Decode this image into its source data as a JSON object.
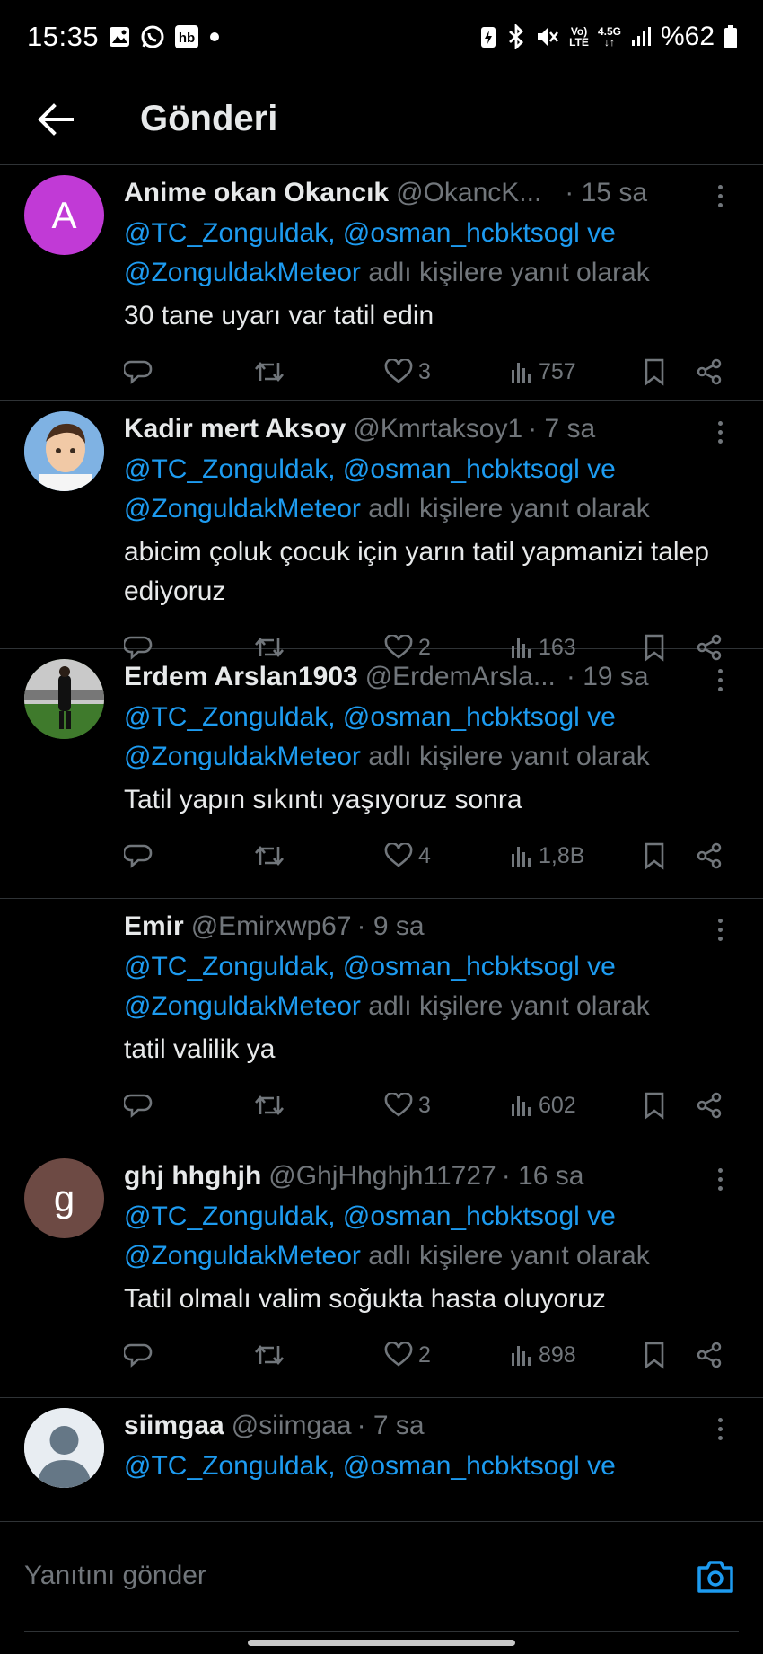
{
  "status_bar": {
    "time": "15:35",
    "left_icons": [
      "image-icon",
      "whatsapp-icon",
      "hb-app-icon",
      "dot-icon"
    ],
    "hb_label": "hb",
    "right_icons": [
      "battery-saver-icon",
      "bluetooth-icon",
      "mute-icon",
      "volte-icon",
      "network-4-5g-icon",
      "signal-icon",
      "battery-icon"
    ],
    "volte_top": "Vo)",
    "volte_bottom": "LTE",
    "network_top": "4.5G",
    "battery": "%62"
  },
  "header": {
    "title": "Gönderi"
  },
  "tweets": [
    {
      "name": "Anime okan Okancık",
      "handle": "@OkancK...",
      "time": "· 15 sa",
      "avatar_letter": "A",
      "avatar_color": "#c13ad6",
      "reply_mentions_1": "@TC_Zonguldak, @osman_hcbktsogl ve",
      "reply_mentions_2": "@ZonguldakMeteor",
      "reply_suffix": "adlı kişilere yanıt olarak",
      "text": "30 tane uyarı  var tatil edin",
      "likes": "3",
      "views": "757"
    },
    {
      "name": "Kadir mert Aksoy",
      "handle": "@Kmrtaksoy1",
      "time": "· 7 sa",
      "avatar_letter": "",
      "avatar_color": "#6ea0d8",
      "reply_mentions_1": "@TC_Zonguldak, @osman_hcbktsogl ve",
      "reply_mentions_2": "@ZonguldakMeteor",
      "reply_suffix": "adlı kişilere yanıt olarak",
      "text": "abicim çoluk çocuk için yarın tatil yapmanizi talep ediyoruz",
      "likes": "2",
      "views": "163"
    },
    {
      "name": "Erdem Arslan1903",
      "handle": "@ErdemArsla...",
      "time": "· 19 sa",
      "avatar_letter": "",
      "avatar_color": "#3b6a2a",
      "reply_mentions_1": "@TC_Zonguldak, @osman_hcbktsogl ve",
      "reply_mentions_2": "@ZonguldakMeteor",
      "reply_suffix": "adlı kişilere yanıt olarak",
      "text": "Tatil yapın sıkıntı yaşıyoruz sonra",
      "likes": "4",
      "views": "1,8B"
    },
    {
      "name": "Emir",
      "handle": "@Emirxwp67",
      "time": "· 9 sa",
      "avatar_letter": "",
      "avatar_color": "#000000",
      "reply_mentions_1": "@TC_Zonguldak, @osman_hcbktsogl ve",
      "reply_mentions_2": "@ZonguldakMeteor",
      "reply_suffix": "adlı kişilere yanıt olarak",
      "text": "tatil valilik ya",
      "likes": "3",
      "views": "602"
    },
    {
      "name": "ghj hhghjh",
      "handle": "@GhjHhghjh11727",
      "time": "· 16 sa",
      "avatar_letter": "g",
      "avatar_color": "#6d4a44",
      "reply_mentions_1": "@TC_Zonguldak, @osman_hcbktsogl ve",
      "reply_mentions_2": "@ZonguldakMeteor",
      "reply_suffix": "adlı kişilere yanıt olarak",
      "text": "Tatil olmalı valim soğukta hasta oluyoruz",
      "likes": "2",
      "views": "898"
    },
    {
      "name": "siimgaa",
      "handle": "@siimgaa",
      "time": "· 7 sa",
      "avatar_letter": "",
      "avatar_color": "#e8edf2",
      "reply_mentions_1": "@TC_Zonguldak, @osman_hcbktsogl ve",
      "reply_mentions_2": "",
      "reply_suffix": "",
      "text": "",
      "likes": "",
      "views": ""
    }
  ],
  "composer": {
    "placeholder": "Yanıtını gönder",
    "accent_color": "#1d9bf0"
  },
  "colors": {
    "background": "#000000",
    "text_primary": "#e7e9ea",
    "text_secondary": "#71767b",
    "link": "#1d9bf0",
    "divider": "#2f3336"
  }
}
